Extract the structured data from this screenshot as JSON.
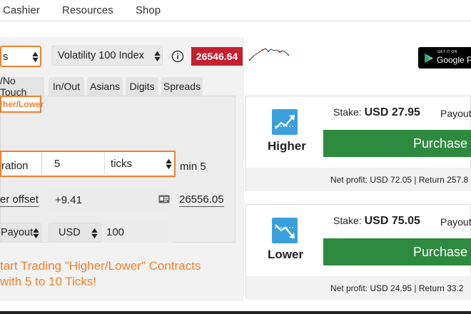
{
  "nav": {
    "items": [
      "Cashier",
      "Resources",
      "Shop"
    ]
  },
  "trade_form": {
    "market_select_value": "s",
    "underlying_select_value": "Volatility 100 Index",
    "spot_price": "26546.64",
    "tabs": [
      "/No Touch",
      "In/Out",
      "Asians",
      "Digits",
      "Spreads"
    ],
    "active_subtab": "her/Lower",
    "duration": {
      "label": "ration",
      "value": "5",
      "unit": "ticks",
      "min_note": "min 5"
    },
    "barrier": {
      "label": "er offset",
      "value": "+9.41",
      "absolute": "26556.05"
    },
    "payout": {
      "basis": "Payout",
      "currency": "USD",
      "amount": "100"
    },
    "promo_lines": [
      "tart Trading \"Higher/Lower\" Contracts",
      "with 5 to 10 Ticks!"
    ]
  },
  "google_play": {
    "small": "GET IT ON",
    "big": "Google P"
  },
  "contracts": [
    {
      "direction": "Higher",
      "stake_label": "Stake:",
      "stake_value": "USD 27.95",
      "payout_label": "Payout",
      "purchase_label": "Purchase",
      "footer": "Net profit: USD 72.05 | Return 257.8"
    },
    {
      "direction": "Lower",
      "stake_label": "Stake:",
      "stake_value": "USD 75.05",
      "payout_label": "Payout",
      "purchase_label": "Purchase",
      "footer": "Net profit: USD 24.95 | Return 33.2"
    }
  ],
  "colors": {
    "accent_orange": "#f0812e",
    "price_red": "#c4202e",
    "purchase_green": "#2e8a3f",
    "icon_blue": "#3aa0dc"
  }
}
